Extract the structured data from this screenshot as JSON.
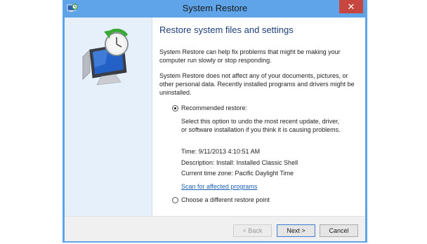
{
  "window": {
    "title": "System Restore",
    "close_glyph": "✕"
  },
  "content": {
    "heading": "Restore system files and settings",
    "para1": "System Restore can help fix problems that might be making your computer run slowly or stop responding.",
    "para2": "System Restore does not affect any of your documents, pictures, or other personal data. Recently installed programs and drivers might be uninstalled.",
    "recommended": {
      "label": "Recommended restore:",
      "selected": true,
      "description": "Select this option to undo the most recent update, driver, or software installation if you think it is causing problems.",
      "time": "Time: 9/11/2013 4:10:51 AM",
      "desc_line": "Description: Install: Installed Classic Shell",
      "timezone": "Current time zone: Pacific Daylight Time",
      "scan_link": "Scan for affected programs"
    },
    "different": {
      "label": "Choose a different restore point",
      "selected": false
    }
  },
  "buttons": {
    "back": "< Back",
    "next": "Next >",
    "cancel": "Cancel"
  },
  "icons": {
    "app": "system-restore-icon",
    "illustration": "system-restore-illustration-icon"
  }
}
